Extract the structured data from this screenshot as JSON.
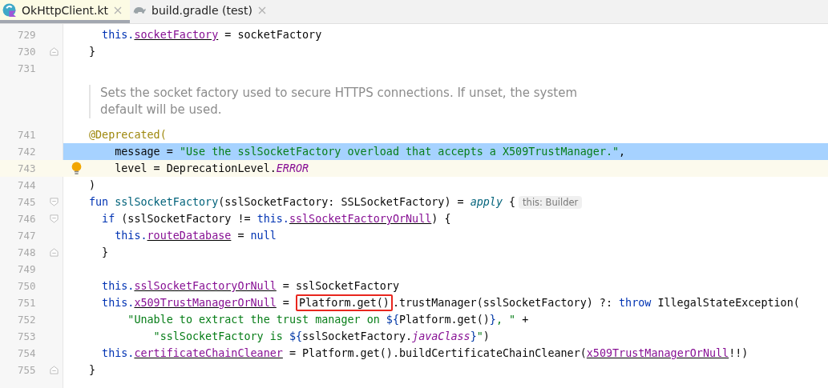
{
  "tabs": [
    {
      "label": "OkHttpClient.kt",
      "kind": "kotlin",
      "selected": true
    },
    {
      "label": "build.gradle (test)",
      "kind": "gradle",
      "selected": false
    }
  ],
  "lines": [
    {
      "kind": "code",
      "number": "729",
      "tokens": [
        {
          "text": "  this.",
          "kind": "keyword"
        },
        {
          "text": "socketFactory",
          "kind": "field"
        },
        {
          "text": " = socketFactory",
          "kind": "plain"
        }
      ]
    },
    {
      "kind": "code",
      "number": "730",
      "fold_end": true,
      "tokens": [
        {
          "text": "}",
          "kind": "plain"
        }
      ]
    },
    {
      "kind": "code",
      "number": "731"
    },
    {
      "kind": "doc",
      "text": "Sets the socket factory used to secure HTTPS connections. If unset, the system default will be used."
    },
    {
      "kind": "code",
      "number": "741",
      "tokens": [
        {
          "text": "@Deprecated(",
          "kind": "annotation"
        }
      ]
    },
    {
      "kind": "code",
      "number": "742",
      "selected": true,
      "tokens": [
        {
          "text": "    message = ",
          "kind": "plain"
        },
        {
          "text": "\"Use the sslSocketFactory overload that accepts a X509TrustManager.\"",
          "kind": "string"
        },
        {
          "text": ",",
          "kind": "plain"
        }
      ]
    },
    {
      "kind": "code",
      "number": "743",
      "current": true,
      "bulb": true,
      "tokens": [
        {
          "text": "    level = DeprecationLevel.",
          "kind": "plain"
        },
        {
          "text": "ERROR",
          "kind": "enum"
        }
      ]
    },
    {
      "kind": "code",
      "number": "744",
      "tokens": [
        {
          "text": ")",
          "kind": "plain"
        }
      ]
    },
    {
      "kind": "code",
      "number": "745",
      "fold_start": true,
      "tokens": [
        {
          "text": "fun ",
          "kind": "keyword"
        },
        {
          "text": "sslSocketFactory",
          "kind": "function"
        },
        {
          "text": "(sslSocketFactory: SSLSocketFactory) = ",
          "kind": "plain"
        },
        {
          "text": "apply",
          "kind": "call"
        },
        {
          "text": " {",
          "kind": "plain"
        }
      ],
      "hint": "this: Builder"
    },
    {
      "kind": "code",
      "number": "746",
      "fold_start": true,
      "tokens": [
        {
          "text": "  if ",
          "kind": "keyword"
        },
        {
          "text": "(sslSocketFactory != ",
          "kind": "plain"
        },
        {
          "text": "this.",
          "kind": "keyword"
        },
        {
          "text": "sslSocketFactoryOrNull",
          "kind": "field"
        },
        {
          "text": ") {",
          "kind": "plain"
        }
      ]
    },
    {
      "kind": "code",
      "number": "747",
      "tokens": [
        {
          "text": "    this.",
          "kind": "keyword"
        },
        {
          "text": "routeDatabase",
          "kind": "field"
        },
        {
          "text": " = ",
          "kind": "plain"
        },
        {
          "text": "null",
          "kind": "keyword"
        }
      ]
    },
    {
      "kind": "code",
      "number": "748",
      "fold_end": true,
      "tokens": [
        {
          "text": "  }",
          "kind": "plain"
        }
      ]
    },
    {
      "kind": "code",
      "number": "749"
    },
    {
      "kind": "code",
      "number": "750",
      "tokens": [
        {
          "text": "  this.",
          "kind": "keyword"
        },
        {
          "text": "sslSocketFactoryOrNull",
          "kind": "field"
        },
        {
          "text": " = sslSocketFactory",
          "kind": "plain"
        }
      ]
    },
    {
      "kind": "code",
      "number": "751",
      "tokens": [
        {
          "text": "  this.",
          "kind": "keyword"
        },
        {
          "text": "x509TrustManagerOrNull",
          "kind": "field"
        },
        {
          "text": " = ",
          "kind": "plain"
        },
        {
          "text": "Platform.get()",
          "kind": "plain",
          "boxed": true
        },
        {
          "text": ".trustManager(sslSocketFactory) ?: ",
          "kind": "plain"
        },
        {
          "text": "throw",
          "kind": "keyword"
        },
        {
          "text": " IllegalStateException(",
          "kind": "plain"
        }
      ]
    },
    {
      "kind": "code",
      "number": "752",
      "tokens": [
        {
          "text": "      \"Unable to extract the trust manager on ",
          "kind": "string"
        },
        {
          "text": "${",
          "kind": "template"
        },
        {
          "text": "Platform.get()",
          "kind": "plain"
        },
        {
          "text": "}",
          "kind": "template"
        },
        {
          "text": ", \"",
          "kind": "string"
        },
        {
          "text": " +",
          "kind": "plain"
        }
      ]
    },
    {
      "kind": "code",
      "number": "753",
      "tokens": [
        {
          "text": "          \"sslSocketFactory is ",
          "kind": "string"
        },
        {
          "text": "${",
          "kind": "template"
        },
        {
          "text": "sslSocketFactory.",
          "kind": "plain"
        },
        {
          "text": "javaClass",
          "kind": "enum"
        },
        {
          "text": "}",
          "kind": "template"
        },
        {
          "text": "\"",
          "kind": "string"
        },
        {
          "text": ")",
          "kind": "plain"
        }
      ]
    },
    {
      "kind": "code",
      "number": "754",
      "tokens": [
        {
          "text": "  this.",
          "kind": "keyword"
        },
        {
          "text": "certificateChainCleaner",
          "kind": "field"
        },
        {
          "text": " = Platform.get().buildCertificateChainCleaner(",
          "kind": "plain"
        },
        {
          "text": "x509TrustManagerOrNull",
          "kind": "field"
        },
        {
          "text": "!!)",
          "kind": "plain"
        }
      ]
    },
    {
      "kind": "code",
      "number": "755",
      "fold_end": true,
      "tokens": [
        {
          "text": "}",
          "kind": "plain"
        }
      ]
    }
  ]
}
